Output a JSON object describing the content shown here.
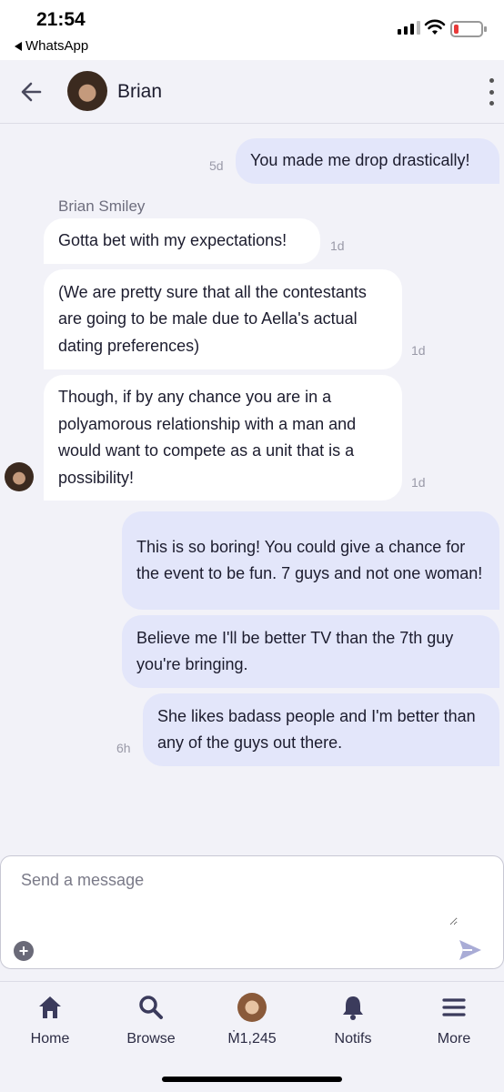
{
  "status_bar": {
    "time": "21:54",
    "back_app": "WhatsApp"
  },
  "header": {
    "contact_name": "Brian",
    "back_icon": "arrow-left-icon",
    "menu_icon": "kebab-menu-icon"
  },
  "messages": [
    {
      "direction": "out",
      "text": "You made me drop drastically!",
      "time": "5d"
    },
    {
      "direction": "in",
      "sender": "Brian Smiley",
      "text": "Gotta bet with my expectations!",
      "time": "1d"
    },
    {
      "direction": "in",
      "text": "(We are pretty sure that all the contestants are going to be male due to Aella's actual dating preferences)",
      "time": "1d"
    },
    {
      "direction": "in",
      "text": "Though, if by any chance you are in a polyamorous relationship with a man and would want to compete as a unit that is a possibility!",
      "time": "1d"
    },
    {
      "direction": "out",
      "text": "This is so boring! You could give a chance for the event to be fun. 7 guys and not one woman!",
      "time": ""
    },
    {
      "direction": "out",
      "text": "Believe me I'll be better TV than the 7th guy you're bringing.",
      "time": ""
    },
    {
      "direction": "out",
      "text": "She likes badass people and I'm better than any of the guys out there.",
      "time": "6h"
    }
  ],
  "composer": {
    "placeholder": "Send a message",
    "value": "",
    "add_icon": "plus-circle-icon",
    "send_icon": "send-icon"
  },
  "bottom_nav": [
    {
      "label": "Home",
      "icon": "home-icon"
    },
    {
      "label": "Browse",
      "icon": "search-icon"
    },
    {
      "label": "Ṁ1,245",
      "icon": "profile-avatar"
    },
    {
      "label": "Notifs",
      "icon": "bell-icon"
    },
    {
      "label": "More",
      "icon": "menu-icon"
    }
  ],
  "colors": {
    "outgoing_bubble": "#e3e6fa",
    "incoming_bubble": "#ffffff",
    "background": "#f2f2f8",
    "nav_icon": "#3b3b5c",
    "send_icon": "#a9acd6"
  }
}
